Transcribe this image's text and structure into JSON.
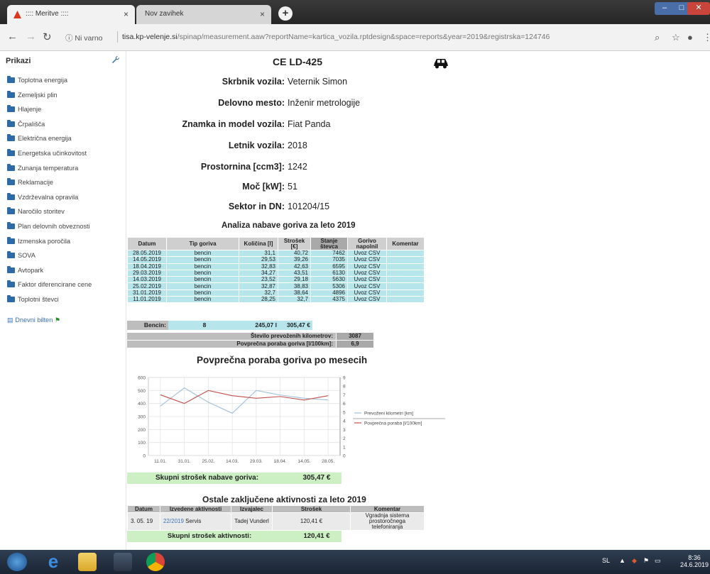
{
  "browser": {
    "tabs": [
      {
        "label": ":::: Meritve ::::",
        "active": true
      },
      {
        "label": "Nov zavihek",
        "active": false
      }
    ],
    "security_text": "Ni varno",
    "url_host": "tisa.kp-velenje.si",
    "url_rest": "/spinap/measurement.aaw?reportName=kartica_vozila.rptdesign&space=reports&year=2019&registrska=124746"
  },
  "sidebar": {
    "title": "Prikazi",
    "items": [
      "Toplotna energija",
      "Zemeljski plin",
      "Hlajenje",
      "Črpališča",
      "Električna energija",
      "Energetska učinkovitost",
      "Zunanja temperatura",
      "Reklamacije",
      "Vzdrževalna opravila",
      "Naročilo storitev",
      "Plan delovnih obveznosti",
      "Izmenska poročila",
      "SOVA",
      "Avtopark",
      "Faktor diferencirane cene",
      "Toplotni števci"
    ],
    "link_item": "Dnevni bilten"
  },
  "vehicle": {
    "title": "CE LD-425",
    "fields": [
      {
        "label": "Skrbnik vozila:",
        "value": "Veternik Simon"
      },
      {
        "label": "Delovno mesto:",
        "value": "Inženir metrologije"
      },
      {
        "label": "Znamka in model vozila:",
        "value": "Fiat Panda"
      },
      {
        "label": "Letnik vozila:",
        "value": "2018"
      },
      {
        "label": "Prostornina [ccm3]:",
        "value": "1242"
      },
      {
        "label": "Moč [kW]:",
        "value": "51"
      },
      {
        "label": "Sektor in DN:",
        "value": "101204/15"
      }
    ]
  },
  "fuel": {
    "title": "Analiza nabave goriva za leto 2019",
    "headers": [
      "Datum",
      "Tip goriva",
      "Količina [l]",
      "Strošek [€]",
      "Stanje števca",
      "Gorivo napolnil",
      "Komentar"
    ],
    "rows": [
      [
        "28.05.2019",
        "bencin",
        "31,1",
        "40,72",
        "7462",
        "Uvoz CSV",
        ""
      ],
      [
        "14.05.2019",
        "bencin",
        "29,53",
        "39,26",
        "7035",
        "Uvoz CSV",
        ""
      ],
      [
        "18.04.2019",
        "bencin",
        "32,83",
        "42,63",
        "6595",
        "Uvoz CSV",
        ""
      ],
      [
        "29.03.2019",
        "bencin",
        "34,27",
        "43,51",
        "6130",
        "Uvoz CSV",
        ""
      ],
      [
        "14.03.2019",
        "bencin",
        "23,52",
        "29,18",
        "5630",
        "Uvoz CSV",
        ""
      ],
      [
        "25.02.2019",
        "bencin",
        "32,87",
        "38,83",
        "5306",
        "Uvoz CSV",
        ""
      ],
      [
        "31.01.2019",
        "bencin",
        "32,7",
        "38,64",
        "4896",
        "Uvoz CSV",
        ""
      ],
      [
        "11.01.2019",
        "bencin",
        "28,25",
        "32,7",
        "4375",
        "Uvoz CSV",
        ""
      ]
    ],
    "summary_label": "Bencin:",
    "summary_count": "8",
    "summary_qty": "245,07 l",
    "summary_cost": "305,47 €",
    "km_label": "Število prevoženih kilometrov:",
    "km_value": "3087",
    "avg_label": "Povprečna poraba goriva [l/100km]:",
    "avg_value": "6,9"
  },
  "chart_title": "Povprečna poraba goriva po mesecih",
  "chart_data": {
    "type": "line",
    "categories": [
      "11.01.",
      "31.01.",
      "25.02.",
      "14.03.",
      "29.03.",
      "18.04.",
      "14.05.",
      "28.05."
    ],
    "series": [
      {
        "name": "Prevoženi kilometri [km]",
        "axis": "left",
        "color": "#9fc0dc",
        "values": [
          380,
          520,
          410,
          325,
          500,
          465,
          440,
          427
        ]
      },
      {
        "name": "Povprečna poraba [l/100km]",
        "axis": "right",
        "color": "#c0504d",
        "values": [
          7.0,
          6.0,
          7.5,
          6.9,
          6.6,
          6.8,
          6.4,
          6.9
        ]
      }
    ],
    "left_ticks": [
      "600",
      "500",
      "400",
      "300",
      "200",
      "100",
      "0"
    ],
    "right_ticks": [
      "9",
      "8",
      "7",
      "6",
      "5",
      "4",
      "3",
      "2",
      "1",
      "0"
    ],
    "ylim_left": [
      0,
      600
    ],
    "ylim_right": [
      0,
      9
    ],
    "grid": true,
    "legend": "right"
  },
  "total_fuel": {
    "label": "Skupni strošek nabave goriva:",
    "value": "305,47 €"
  },
  "other": {
    "title": "Ostale zaključene aktivnosti za leto 2019",
    "headers": [
      "Datum",
      "Izvedene aktivnosti",
      "Izvajalec",
      "Strošek",
      "Komentar"
    ],
    "row": {
      "date": "3. 05. 19",
      "link": "22/2019",
      "activity": "Servis",
      "provider": "Tadej Vunderl",
      "cost": "120,41 €",
      "comment": "Vgradnja sistema prostoročnega telefoniranja"
    },
    "total_label": "Skupni strošek aktivnosti:",
    "total_value": "120,41 €"
  },
  "taskbar": {
    "lang": "SL",
    "time": "8:36",
    "date": "24.6.2019"
  }
}
